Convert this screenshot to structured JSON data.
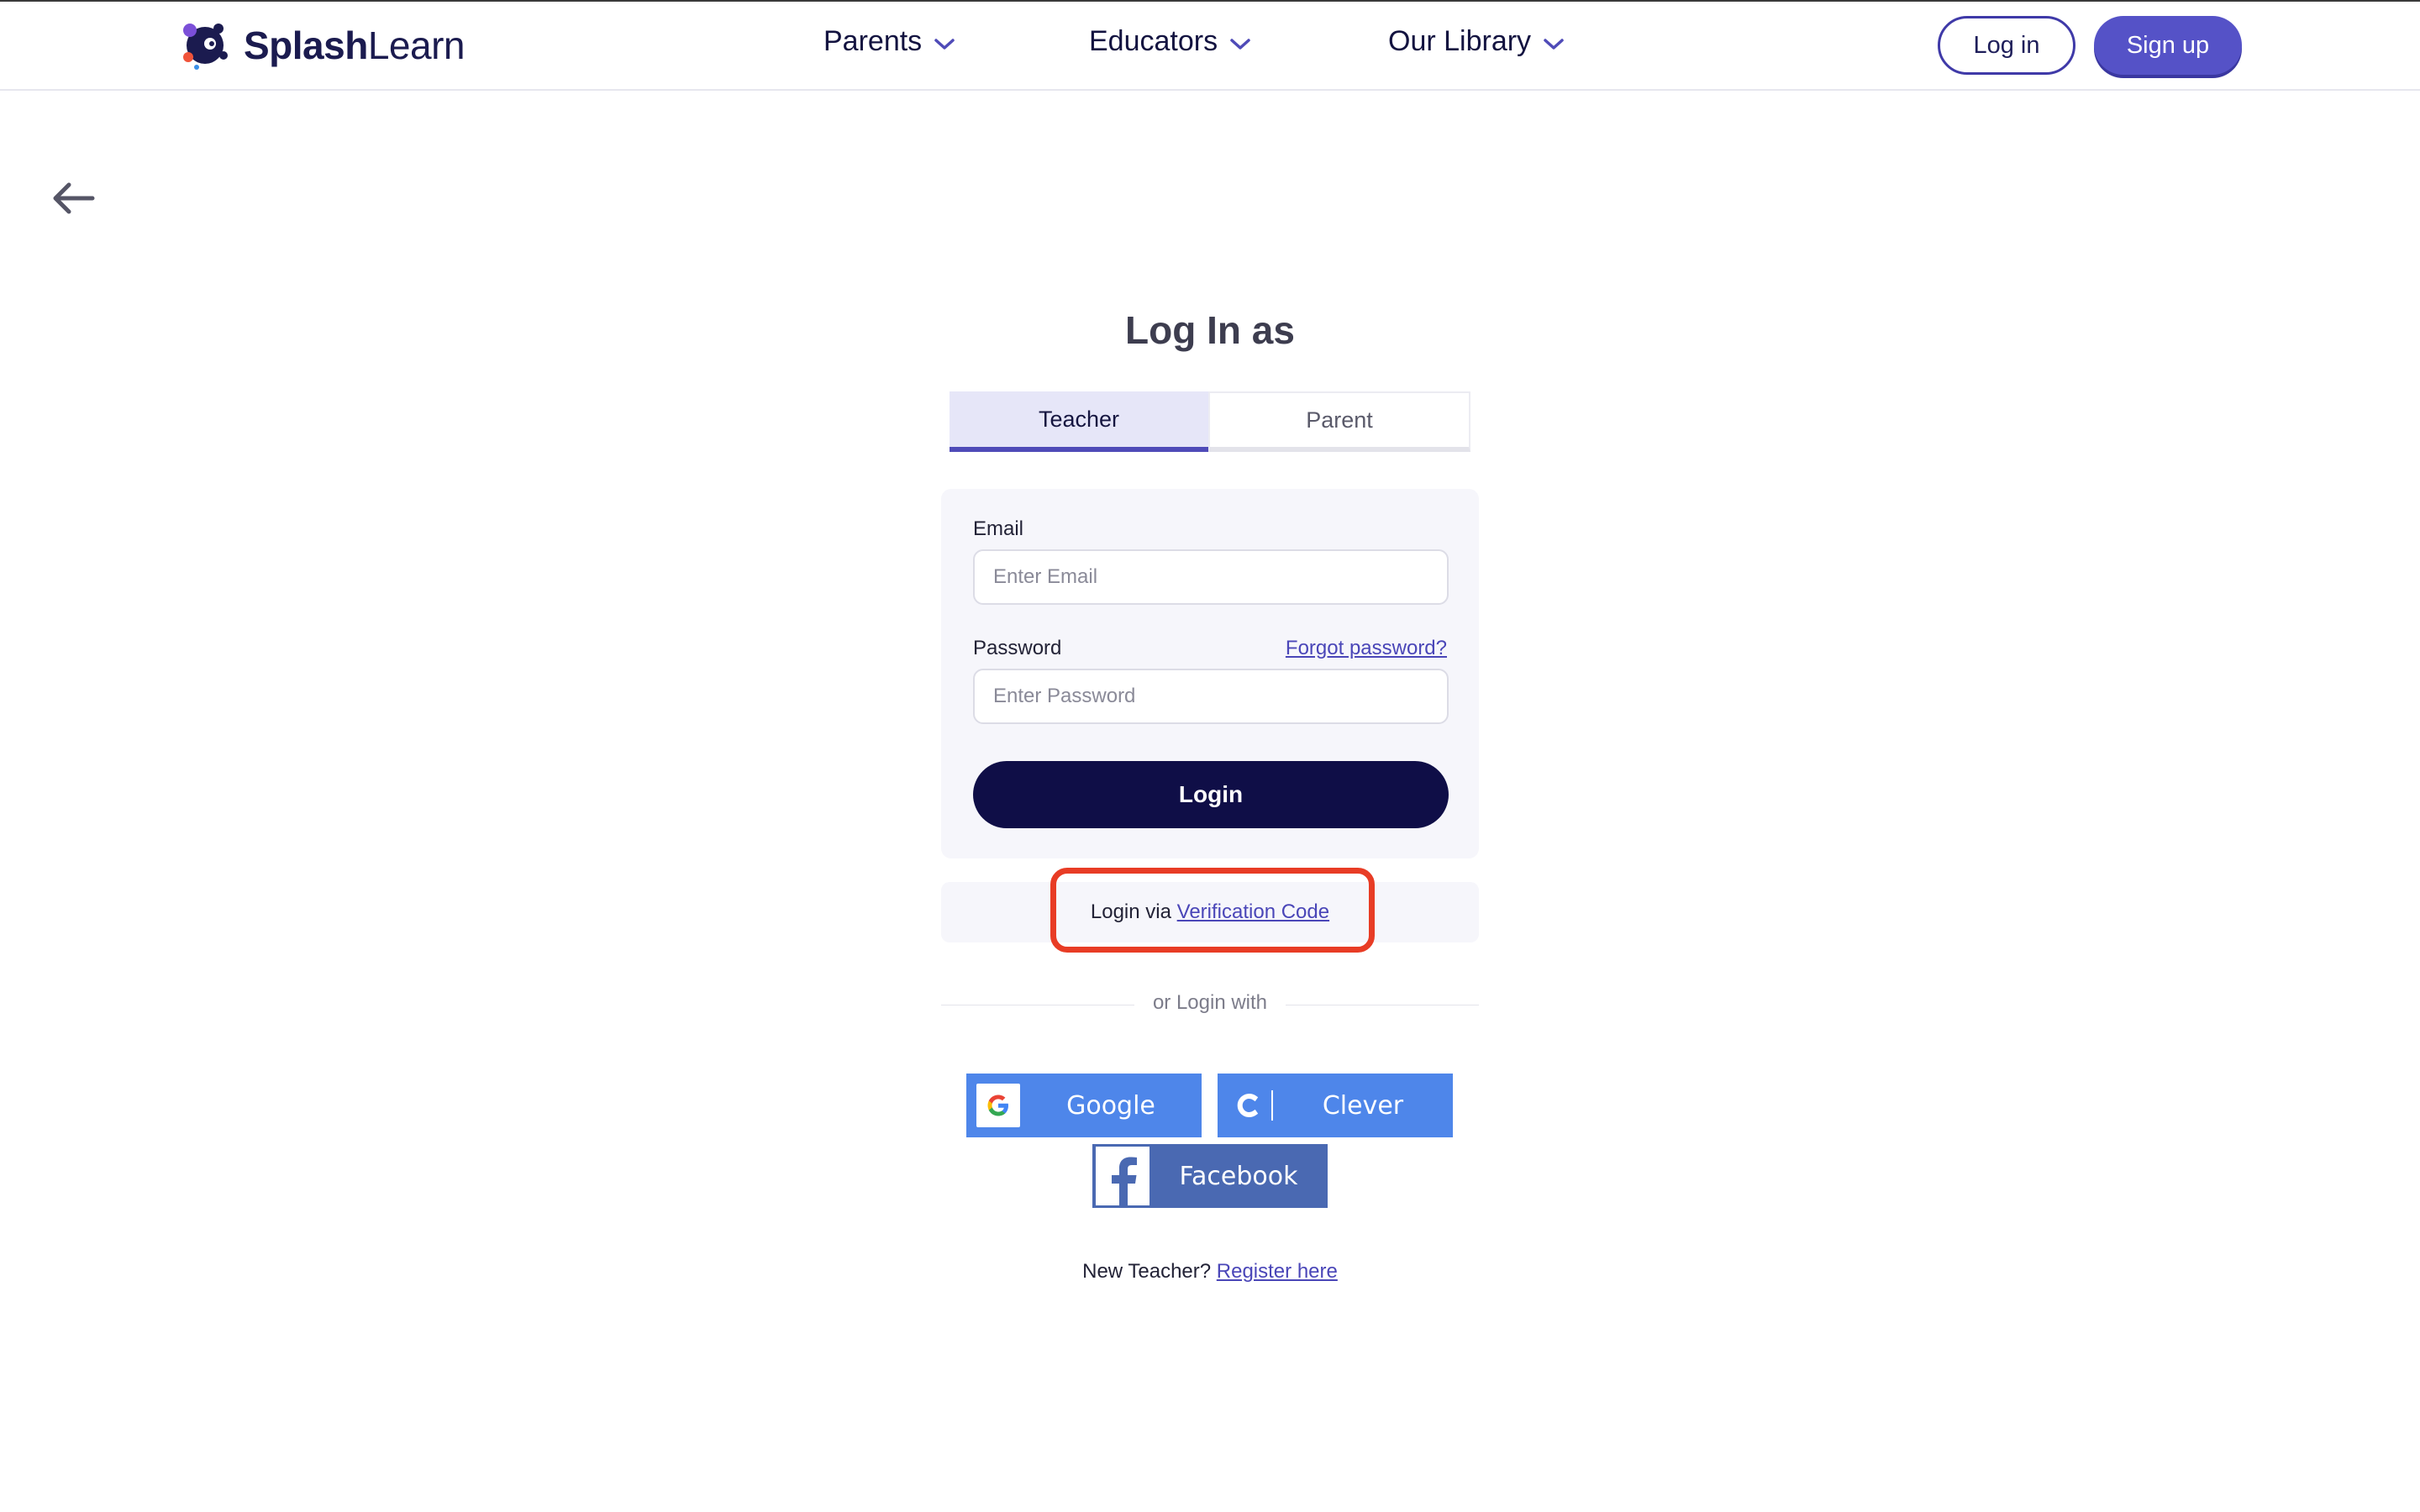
{
  "header": {
    "brand_bold": "Splash",
    "brand_light": "Learn",
    "nav": [
      {
        "label": "Parents"
      },
      {
        "label": "Educators"
      },
      {
        "label": "Our Library"
      }
    ],
    "login_label": "Log in",
    "signup_label": "Sign up"
  },
  "page": {
    "title": "Log In as",
    "tabs": [
      {
        "label": "Teacher",
        "active": true
      },
      {
        "label": "Parent",
        "active": false
      }
    ]
  },
  "form": {
    "email_label": "Email",
    "email_placeholder": "Enter Email",
    "password_label": "Password",
    "password_placeholder": "Enter Password",
    "forgot_label": "Forgot password?",
    "login_button": "Login"
  },
  "verification": {
    "prefix": "Login via ",
    "link": "Verification Code"
  },
  "sso": {
    "divider": "or Login with",
    "google": "Google",
    "clever": "Clever",
    "facebook": "Facebook"
  },
  "register": {
    "prefix": "New Teacher? ",
    "link": "Register here"
  },
  "colors": {
    "brand_navy": "#0f0e47",
    "brand_purple": "#5552c7",
    "google_blue": "#4e86ea",
    "facebook_blue": "#4a69b2",
    "highlight_red": "#e83c25"
  }
}
